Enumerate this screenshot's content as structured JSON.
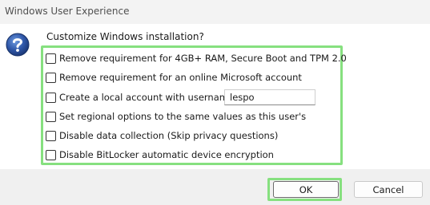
{
  "window": {
    "title": "Windows User Experience"
  },
  "prompt": "Customize Windows installation?",
  "options": [
    {
      "label": "Remove requirement for 4GB+ RAM, Secure Boot and TPM 2.0",
      "checked": false
    },
    {
      "label": "Remove requirement for an online Microsoft account",
      "checked": false
    },
    {
      "label": "Create a local account with username:",
      "checked": false
    },
    {
      "label": "Set regional options to the same values as this user's",
      "checked": false
    },
    {
      "label": "Disable data collection (Skip privacy questions)",
      "checked": false
    },
    {
      "label": "Disable BitLocker automatic device encryption",
      "checked": false
    }
  ],
  "username_field": {
    "value": "lespo"
  },
  "buttons": {
    "ok": "OK",
    "cancel": "Cancel"
  },
  "icons": {
    "dialog": "question-icon"
  },
  "colors": {
    "highlight": "#86e07f",
    "icon_blue": "#2f57a8"
  }
}
